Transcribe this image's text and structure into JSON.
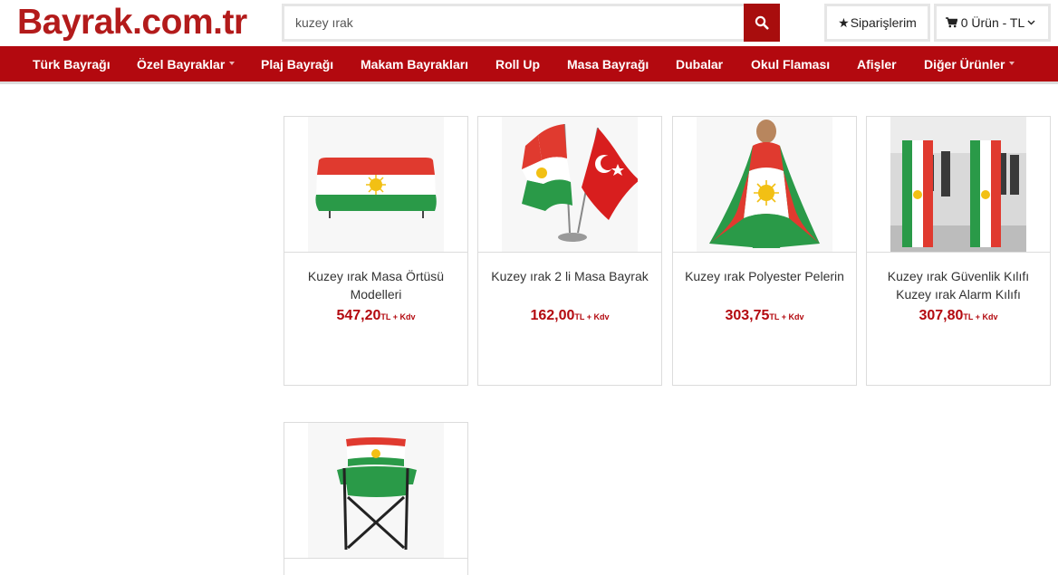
{
  "header": {
    "logo": "Bayrak.com.tr",
    "search": {
      "value": "kuzey ırak",
      "placeholder": ""
    },
    "orders_label": "Siparişlerim",
    "cart_label": "0 Ürün - TL"
  },
  "nav": {
    "items": [
      {
        "label": "Türk Bayrağı",
        "has_dropdown": false
      },
      {
        "label": "Özel Bayraklar",
        "has_dropdown": true
      },
      {
        "label": "Plaj Bayrağı",
        "has_dropdown": false
      },
      {
        "label": "Makam Bayrakları",
        "has_dropdown": false
      },
      {
        "label": "Roll Up",
        "has_dropdown": false
      },
      {
        "label": "Masa Bayrağı",
        "has_dropdown": false
      },
      {
        "label": "Dubalar",
        "has_dropdown": false
      },
      {
        "label": "Okul Flaması",
        "has_dropdown": false
      },
      {
        "label": "Afişler",
        "has_dropdown": false
      },
      {
        "label": "Diğer Ürünler",
        "has_dropdown": true
      }
    ]
  },
  "colors": {
    "brand_red": "#b3090f",
    "logo_red": "#b31b1b",
    "flag_red": "#e03a2f",
    "flag_green": "#2a9a48",
    "flag_sun": "#f2c014"
  },
  "products": [
    {
      "title": "Kuzey ırak Masa Örtüsü Modelleri",
      "price": "547,20",
      "currency": "TL",
      "tax_note": " + Kdv",
      "image": "table-cover"
    },
    {
      "title": "Kuzey ırak 2 li Masa Bayrak",
      "price": "162,00",
      "currency": "TL",
      "tax_note": " + Kdv",
      "image": "desk-flags"
    },
    {
      "title": "Kuzey ırak Polyester Pelerin",
      "price": "303,75",
      "currency": "TL",
      "tax_note": " + Kdv",
      "image": "cape"
    },
    {
      "title": "Kuzey ırak Güvenlik Kılıfı Kuzey ırak Alarm Kılıfı",
      "price": "307,80",
      "currency": "TL",
      "tax_note": " + Kdv",
      "image": "security-cover"
    },
    {
      "title": "",
      "price": "",
      "currency": "",
      "tax_note": "",
      "image": "chair"
    }
  ]
}
